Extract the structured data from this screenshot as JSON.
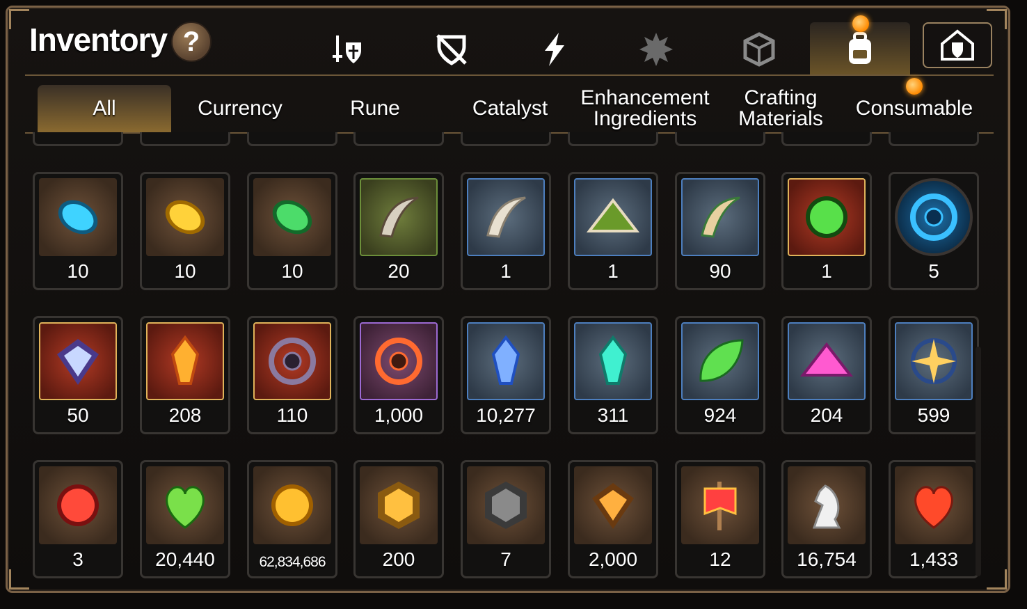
{
  "header": {
    "title": "Inventory",
    "help_label": "?"
  },
  "top_tabs": [
    {
      "icon": "sword-shield-icon",
      "active": false
    },
    {
      "icon": "broken-shield-icon",
      "active": false
    },
    {
      "icon": "lightning-icon",
      "active": false
    },
    {
      "icon": "splat-emblem-icon",
      "active": false
    },
    {
      "icon": "cube-icon",
      "active": false
    },
    {
      "icon": "backpack-icon",
      "active": true,
      "notify": true
    },
    {
      "icon": "house-shield-icon",
      "active": false,
      "notify": true
    }
  ],
  "category_tabs": [
    {
      "label": "All",
      "active": true
    },
    {
      "label": "Currency"
    },
    {
      "label": "Rune"
    },
    {
      "label": "Catalyst"
    },
    {
      "label": "Enhancement Ingredients"
    },
    {
      "label": "Crafting Materials"
    },
    {
      "label": "Consumable",
      "notify": true
    }
  ],
  "items": [
    [
      {
        "icon": "blue-snowflake-gem-icon",
        "count": "10",
        "frame": "brown"
      },
      {
        "icon": "yellow-gem-icon",
        "count": "10",
        "frame": "brown"
      },
      {
        "icon": "green-gem-icon",
        "count": "10",
        "frame": "brown"
      },
      {
        "icon": "claw-icon",
        "count": "20",
        "frame": "green"
      },
      {
        "icon": "fang-icon",
        "count": "1",
        "frame": "blue"
      },
      {
        "icon": "moss-pile-icon",
        "count": "1",
        "frame": "blue"
      },
      {
        "icon": "root-icon",
        "count": "90",
        "frame": "blue"
      },
      {
        "icon": "green-orb-icon",
        "count": "1",
        "frame": "red"
      },
      {
        "icon": "blue-portal-icon",
        "count": "5",
        "frame": "round"
      }
    ],
    [
      {
        "icon": "eye-emblem-icon",
        "count": "50",
        "frame": "red"
      },
      {
        "icon": "fire-crystal-icon",
        "count": "208",
        "frame": "red"
      },
      {
        "icon": "dark-ring-icon",
        "count": "110",
        "frame": "red"
      },
      {
        "icon": "red-ring-icon",
        "count": "1,000",
        "frame": "purple"
      },
      {
        "icon": "blue-crystal-icon",
        "count": "10,277",
        "frame": "blue"
      },
      {
        "icon": "teal-crystal-icon",
        "count": "311",
        "frame": "blue"
      },
      {
        "icon": "leaf-icon",
        "count": "924",
        "frame": "blue"
      },
      {
        "icon": "pink-crystal-pile-icon",
        "count": "204",
        "frame": "blue"
      },
      {
        "icon": "star-ring-icon",
        "count": "599",
        "frame": "blue"
      }
    ],
    [
      {
        "icon": "red-seal-icon",
        "count": "3",
        "frame": "brown"
      },
      {
        "icon": "green-heart-icon",
        "count": "20,440",
        "frame": "brown"
      },
      {
        "icon": "gold-coin-icon",
        "count": "62,834,686",
        "frame": "brown",
        "small": true
      },
      {
        "icon": "gold-emblem-icon",
        "count": "200",
        "frame": "brown"
      },
      {
        "icon": "stone-compass-icon",
        "count": "7",
        "frame": "brown"
      },
      {
        "icon": "fist-emblem-icon",
        "count": "2,000",
        "frame": "brown"
      },
      {
        "icon": "banner-icon",
        "count": "12",
        "frame": "brown"
      },
      {
        "icon": "chess-knight-icon",
        "count": "16,754",
        "frame": "brown"
      },
      {
        "icon": "red-leaf-icon",
        "count": "1,433",
        "frame": "brown"
      }
    ]
  ],
  "partial_row_count": 9,
  "colors": {
    "accent_orange": "#ff8a00",
    "gold_border": "#a3855d",
    "active_tab": "#8a6a30"
  }
}
